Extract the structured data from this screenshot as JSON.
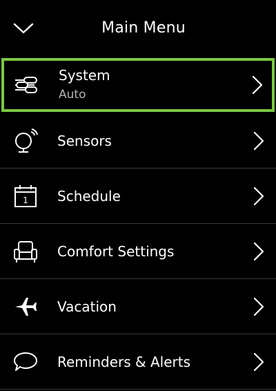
{
  "header": {
    "title": "Main Menu",
    "collapse_icon": "chevron-down-icon"
  },
  "menu": {
    "items": [
      {
        "label": "System",
        "sublabel": "Auto",
        "icon": "system-sliders-icon",
        "selected": true
      },
      {
        "label": "Sensors",
        "icon": "sensor-icon"
      },
      {
        "label": "Schedule",
        "icon": "calendar-icon",
        "icon_text": "1"
      },
      {
        "label": "Comfort Settings",
        "icon": "armchair-icon"
      },
      {
        "label": "Vacation",
        "icon": "airplane-icon"
      },
      {
        "label": "Reminders & Alerts",
        "icon": "speech-bubble-icon"
      }
    ]
  },
  "colors": {
    "background": "#000000",
    "text": "#ffffff",
    "subtext": "#b4b4b4",
    "selection_border": "#7ac943",
    "divider": "#3a3a3a"
  }
}
